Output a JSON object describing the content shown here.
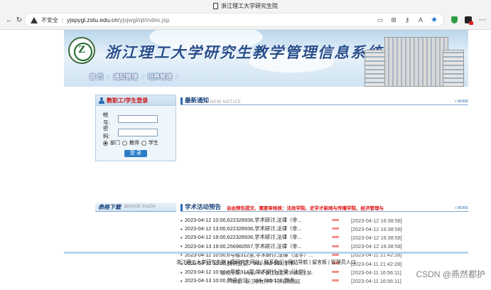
{
  "browser": {
    "tab_title": "浙江理工大学研究生院",
    "not_secure": "不安全",
    "url_host": "yjspygl.zstu.edu.cn",
    "url_path": "/yjsjwgl/qt/index.jsp",
    "icons": [
      "reader-icon",
      "grid-icon",
      "key-icon",
      "read-aloud-icon",
      "favorite-star-icon",
      "extension-shield-icon",
      "extension-icon",
      "menu-icon"
    ]
  },
  "site": {
    "title": "浙江理工大学研究生教学管理信息系统",
    "nav": [
      "首 页",
      "通知管理",
      "培养管理"
    ],
    "nav_sep": "/"
  },
  "login": {
    "title": "教职工/学生登录",
    "account_label": "帐 号:",
    "password_label": "密 码:",
    "roles": [
      "部门",
      "教师",
      "学生"
    ],
    "button": "登 录"
  },
  "notice": {
    "title": "最新通知",
    "sub": "NEW NOTICE",
    "more": "» MORE"
  },
  "downloads": {
    "title": "表格下载",
    "sub": "BIAOGE XIAZAI"
  },
  "lectures": {
    "title": "学术活动预告",
    "alert": "自由预告提交、需要审核核：法政学院、史学才新闻与传播学院、经济管理与",
    "more": "» MORE",
    "new_tag": "new",
    "items": [
      {
        "text": "2023-04-12 10:00,622328936,学术研讨,法律（非...",
        "date": "[2023-04-12 16:38:58]"
      },
      {
        "text": "2023-04-12 13:00,622328936,学术研讨,法律（非...",
        "date": "[2023-04-12 16:38:58]"
      },
      {
        "text": "2023-04-12 19:00,622328936,学术研讨,法律（非...",
        "date": "[2023-04-12 16:38:58]"
      },
      {
        "text": "2023-04-13 19:00,256960557,学术研讨,法律（非...",
        "date": "[2023-04-12 16:38:58]"
      },
      {
        "text": "2023-04-12 10:00,6号楼312室,学术研讨,法律（法学）...",
        "date": "[2023-04-11 21:42:28]"
      },
      {
        "text": "2023-04-12 10:00,腾讯会议：301-392-553,学术...",
        "date": "[2023-04-11 21:42:28]"
      },
      {
        "text": "2023-04-12 10:00,6号楼314室,学术研讨,法律（法学）...",
        "date": "[2023-04-11 16:56:11]"
      },
      {
        "text": "2023-04-13 10:00,腾讯会议：196-780-128,学术...",
        "date": "[2023-04-11 16:56:11]"
      }
    ]
  },
  "footer": {
    "links": "浙江理工大学研究生院 | 原研究生网站 | 联系我们 | 网站导航 | 留言板 | 管理员入口",
    "copyright": "版权所有：copy2009 浙江理工大学研究生部",
    "address": "地址：浙江省杭州市下沙高教园区"
  },
  "watermark": "CSDN @燕然都护"
}
